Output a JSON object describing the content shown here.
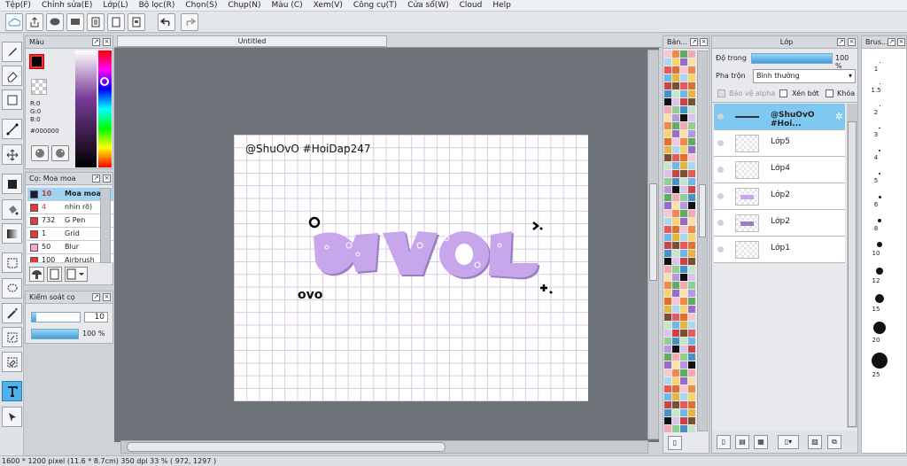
{
  "menu": [
    "Tệp(F)",
    "Chỉnh sửa(E)",
    "Lớp(L)",
    "Bộ lọc(R)",
    "Chọn(S)",
    "Chụp(N)",
    "Màu (C)",
    "Xem(V)",
    "Công cụ(T)",
    "Cửa sổ(W)",
    "Cloud",
    "Help"
  ],
  "color_panel": {
    "title": "Màu",
    "r": "R:0",
    "g": "G:0",
    "b": "B:0",
    "hex": "#000000",
    "fg": "#000000"
  },
  "brush_panel": {
    "title": "Cọ: Moa moa",
    "rows": [
      {
        "n": "10",
        "label": "Moa moa",
        "color": "#1a1a3a"
      },
      {
        "n": "4",
        "label": "nhìn rõ)",
        "color": "#e03a3a"
      },
      {
        "n": "732",
        "label": "G Pen",
        "color": "#e03a3a"
      },
      {
        "n": "1",
        "label": "Grid",
        "color": "#e03a3a"
      },
      {
        "n": "50",
        "label": "Blur",
        "color": "#f3a8cf"
      },
      {
        "n": "100",
        "label": "Airbrush",
        "color": "#e03a3a"
      }
    ]
  },
  "brush_control": {
    "title": "Kiểm soát cọ",
    "size": "10",
    "opacity": "100 %",
    "size_fill": 0.1,
    "opacity_fill": 1.0
  },
  "canvas": {
    "tab": "Untitled",
    "watermark": "@ShuOvO #HoiDap247",
    "art_text": "ovo"
  },
  "palette_panel": {
    "title": "Bản..."
  },
  "layer_panel": {
    "title": "Lớp",
    "opacity_label": "Độ trong",
    "opacity_value": "100 %",
    "opacity_fill": 1.0,
    "blend_label": "Pha trộn",
    "blend_value": "Bình thường",
    "protect_alpha": "Bảo vệ alpha",
    "clip": "Xén bớt",
    "lock": "Khóa",
    "layers": [
      "@ShuOvO #Hoi...",
      "Lớp5",
      "Lớp4",
      "Lớp2",
      "Lớp2",
      "Lớp1"
    ],
    "selected": 0
  },
  "brush_size_panel": {
    "title": "Brus...",
    "labels": [
      "1",
      "1.5",
      "2",
      "3",
      "4",
      "5",
      "6",
      "8",
      "10",
      "12",
      "15",
      "20",
      "25"
    ]
  },
  "status": {
    "text": "1600 * 1200 pixel   (11.6 * 8.7cm)   350 dpi   33 %   ( 972, 1297 )"
  },
  "colors": {
    "accent": "#4fb3ea",
    "selected_layer": "#7fc8f1",
    "lilac": "#c7a6ec"
  }
}
